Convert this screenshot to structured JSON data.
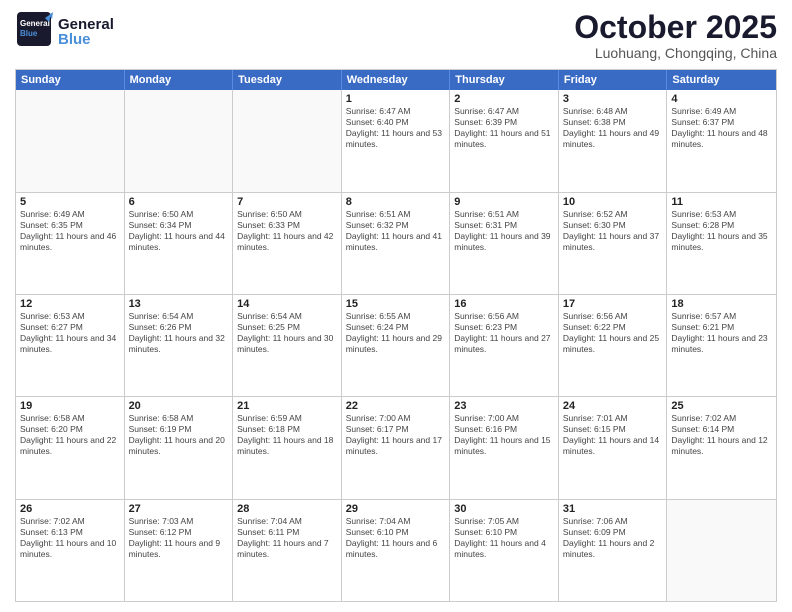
{
  "header": {
    "logo_general": "General",
    "logo_blue": "Blue",
    "month_title": "October 2025",
    "location": "Luohuang, Chongqing, China"
  },
  "days_of_week": [
    "Sunday",
    "Monday",
    "Tuesday",
    "Wednesday",
    "Thursday",
    "Friday",
    "Saturday"
  ],
  "weeks": [
    [
      {
        "date": "",
        "empty": true
      },
      {
        "date": "",
        "empty": true
      },
      {
        "date": "",
        "empty": true
      },
      {
        "date": "1",
        "sunrise": "6:47 AM",
        "sunset": "6:40 PM",
        "daylight": "11 hours and 53 minutes."
      },
      {
        "date": "2",
        "sunrise": "6:47 AM",
        "sunset": "6:39 PM",
        "daylight": "11 hours and 51 minutes."
      },
      {
        "date": "3",
        "sunrise": "6:48 AM",
        "sunset": "6:38 PM",
        "daylight": "11 hours and 49 minutes."
      },
      {
        "date": "4",
        "sunrise": "6:49 AM",
        "sunset": "6:37 PM",
        "daylight": "11 hours and 48 minutes."
      }
    ],
    [
      {
        "date": "5",
        "sunrise": "6:49 AM",
        "sunset": "6:35 PM",
        "daylight": "11 hours and 46 minutes."
      },
      {
        "date": "6",
        "sunrise": "6:50 AM",
        "sunset": "6:34 PM",
        "daylight": "11 hours and 44 minutes."
      },
      {
        "date": "7",
        "sunrise": "6:50 AM",
        "sunset": "6:33 PM",
        "daylight": "11 hours and 42 minutes."
      },
      {
        "date": "8",
        "sunrise": "6:51 AM",
        "sunset": "6:32 PM",
        "daylight": "11 hours and 41 minutes."
      },
      {
        "date": "9",
        "sunrise": "6:51 AM",
        "sunset": "6:31 PM",
        "daylight": "11 hours and 39 minutes."
      },
      {
        "date": "10",
        "sunrise": "6:52 AM",
        "sunset": "6:30 PM",
        "daylight": "11 hours and 37 minutes."
      },
      {
        "date": "11",
        "sunrise": "6:53 AM",
        "sunset": "6:28 PM",
        "daylight": "11 hours and 35 minutes."
      }
    ],
    [
      {
        "date": "12",
        "sunrise": "6:53 AM",
        "sunset": "6:27 PM",
        "daylight": "11 hours and 34 minutes."
      },
      {
        "date": "13",
        "sunrise": "6:54 AM",
        "sunset": "6:26 PM",
        "daylight": "11 hours and 32 minutes."
      },
      {
        "date": "14",
        "sunrise": "6:54 AM",
        "sunset": "6:25 PM",
        "daylight": "11 hours and 30 minutes."
      },
      {
        "date": "15",
        "sunrise": "6:55 AM",
        "sunset": "6:24 PM",
        "daylight": "11 hours and 29 minutes."
      },
      {
        "date": "16",
        "sunrise": "6:56 AM",
        "sunset": "6:23 PM",
        "daylight": "11 hours and 27 minutes."
      },
      {
        "date": "17",
        "sunrise": "6:56 AM",
        "sunset": "6:22 PM",
        "daylight": "11 hours and 25 minutes."
      },
      {
        "date": "18",
        "sunrise": "6:57 AM",
        "sunset": "6:21 PM",
        "daylight": "11 hours and 23 minutes."
      }
    ],
    [
      {
        "date": "19",
        "sunrise": "6:58 AM",
        "sunset": "6:20 PM",
        "daylight": "11 hours and 22 minutes."
      },
      {
        "date": "20",
        "sunrise": "6:58 AM",
        "sunset": "6:19 PM",
        "daylight": "11 hours and 20 minutes."
      },
      {
        "date": "21",
        "sunrise": "6:59 AM",
        "sunset": "6:18 PM",
        "daylight": "11 hours and 18 minutes."
      },
      {
        "date": "22",
        "sunrise": "7:00 AM",
        "sunset": "6:17 PM",
        "daylight": "11 hours and 17 minutes."
      },
      {
        "date": "23",
        "sunrise": "7:00 AM",
        "sunset": "6:16 PM",
        "daylight": "11 hours and 15 minutes."
      },
      {
        "date": "24",
        "sunrise": "7:01 AM",
        "sunset": "6:15 PM",
        "daylight": "11 hours and 14 minutes."
      },
      {
        "date": "25",
        "sunrise": "7:02 AM",
        "sunset": "6:14 PM",
        "daylight": "11 hours and 12 minutes."
      }
    ],
    [
      {
        "date": "26",
        "sunrise": "7:02 AM",
        "sunset": "6:13 PM",
        "daylight": "11 hours and 10 minutes."
      },
      {
        "date": "27",
        "sunrise": "7:03 AM",
        "sunset": "6:12 PM",
        "daylight": "11 hours and 9 minutes."
      },
      {
        "date": "28",
        "sunrise": "7:04 AM",
        "sunset": "6:11 PM",
        "daylight": "11 hours and 7 minutes."
      },
      {
        "date": "29",
        "sunrise": "7:04 AM",
        "sunset": "6:10 PM",
        "daylight": "11 hours and 6 minutes."
      },
      {
        "date": "30",
        "sunrise": "7:05 AM",
        "sunset": "6:10 PM",
        "daylight": "11 hours and 4 minutes."
      },
      {
        "date": "31",
        "sunrise": "7:06 AM",
        "sunset": "6:09 PM",
        "daylight": "11 hours and 2 minutes."
      },
      {
        "date": "",
        "empty": true
      }
    ]
  ],
  "labels": {
    "sunrise": "Sunrise:",
    "sunset": "Sunset:",
    "daylight": "Daylight:"
  }
}
